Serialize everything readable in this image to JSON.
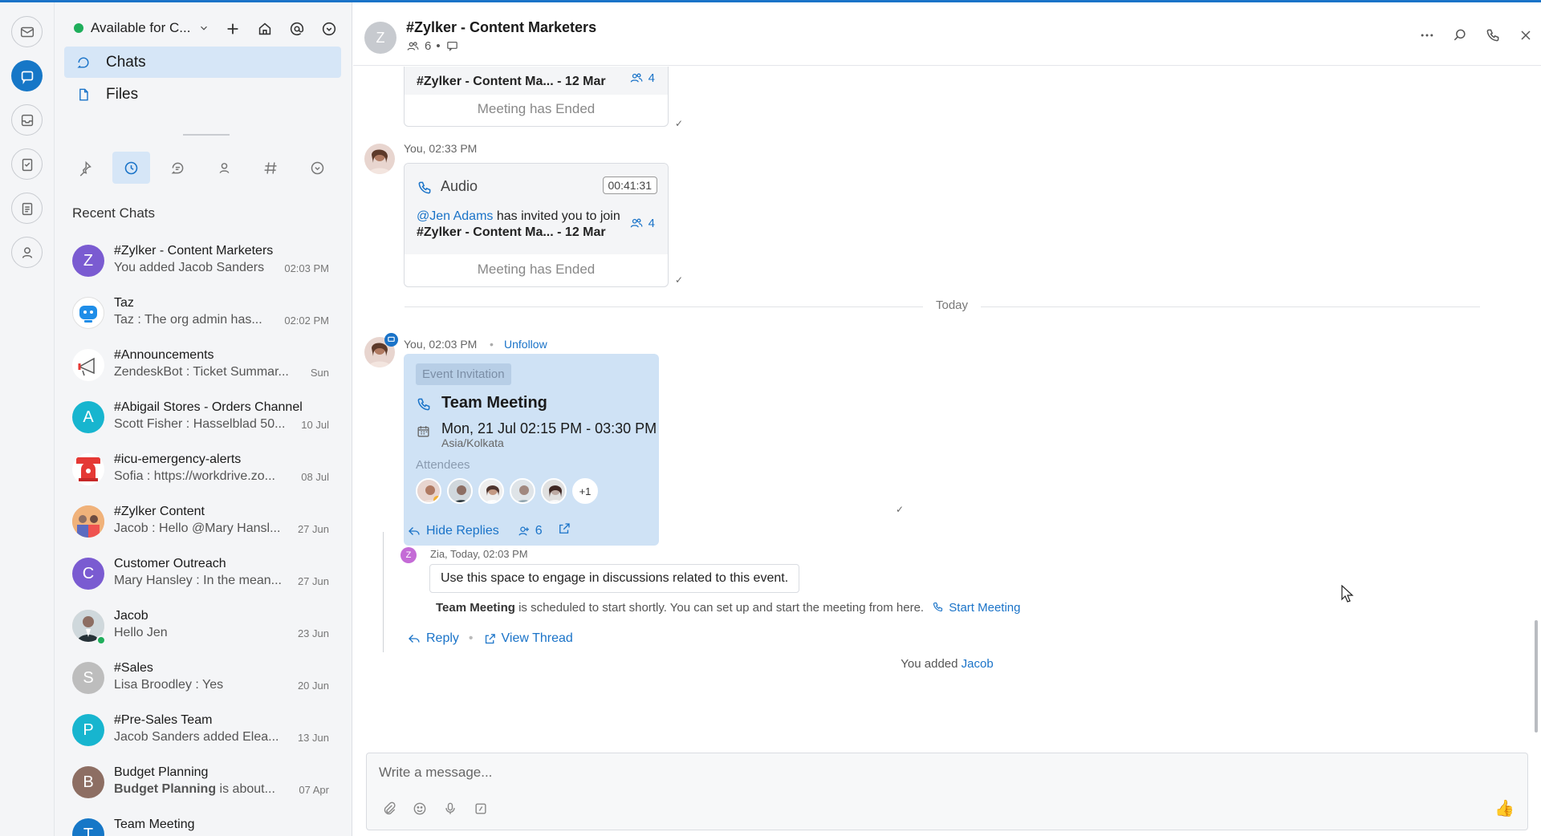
{
  "app": {
    "accent": "#1677c7"
  },
  "rail": {
    "items": [
      "mail-icon",
      "chat-icon",
      "inbox-icon",
      "tasks-icon",
      "notes-icon",
      "contacts-icon"
    ]
  },
  "sidebar": {
    "status": "Available for C...",
    "nav": [
      {
        "label": "Chats"
      },
      {
        "label": "Files"
      }
    ],
    "section_title": "Recent Chats",
    "chats": [
      {
        "name": "#Zylker - Content Marketers",
        "preview": "You added Jacob Sanders",
        "time": "02:03 PM",
        "avatar_letter": "Z",
        "color": "#7a5bd1"
      },
      {
        "name": "Taz",
        "preview": "Taz : The org admin has...",
        "time": "02:02 PM",
        "avatar_letter": "",
        "color": "#1f8de8"
      },
      {
        "name": "#Announcements",
        "preview": "ZendeskBot : Ticket Summar...",
        "time": "Sun",
        "avatar_letter": "",
        "color": "#f0f0f0"
      },
      {
        "name": "#Abigail Stores - Orders Channel",
        "preview": "Scott Fisher : Hasselblad 50...",
        "time": "10 Jul",
        "avatar_letter": "A",
        "color": "#17b5cf"
      },
      {
        "name": "#icu-emergency-alerts",
        "preview": "Sofia : https://workdrive.zo...",
        "time": "08 Jul",
        "avatar_letter": "",
        "color": "#e53935"
      },
      {
        "name": "#Zylker Content",
        "preview": "Jacob : Hello @Mary Hansl...",
        "time": "27 Jun",
        "avatar_letter": "",
        "color": "#e98f5a"
      },
      {
        "name": "Customer Outreach",
        "preview": "Mary Hansley : In the mean...",
        "time": "27 Jun",
        "avatar_letter": "C",
        "color": "#7a5bd1"
      },
      {
        "name": "Jacob",
        "preview": "Hello Jen",
        "time": "23 Jun",
        "avatar_letter": "",
        "color": "#8d6e63"
      },
      {
        "name": "#Sales",
        "preview": "Lisa Broodley : Yes",
        "time": "20 Jun",
        "avatar_letter": "S",
        "color": "#bdbdbd"
      },
      {
        "name": "#Pre-Sales Team",
        "preview": "Jacob Sanders added Elea...",
        "time": "13 Jun",
        "avatar_letter": "P",
        "color": "#17b5cf"
      },
      {
        "name": "Budget Planning",
        "preview_bold": "Budget Planning",
        "preview": " is about...",
        "time": "07 Apr",
        "avatar_letter": "B",
        "color": "#8d6e63"
      },
      {
        "name": "Team Meeting",
        "preview": "",
        "time": "",
        "avatar_letter": "T",
        "color": "#1677c7"
      }
    ]
  },
  "header": {
    "avatar_letter": "Z",
    "title": "#Zylker - Content Marketers",
    "member_count": "6"
  },
  "conversation": {
    "msg1": {
      "title": "#Zylker - Content Ma... - 12 Mar",
      "count": "4",
      "ended": "Meeting has Ended"
    },
    "msg2": {
      "sender": "You, 02:33 PM",
      "type": "Audio",
      "duration": "00:41:31",
      "mention": "@Jen Adams",
      "invite_text": " has invited you to join",
      "title": "#Zylker - Content Ma... - 12 Mar",
      "count": "4",
      "ended": "Meeting has Ended"
    },
    "divider": "Today",
    "msg3": {
      "sender": "You, 02:03 PM",
      "follow": "Unfollow",
      "tag": "Event Invitation",
      "title": "Team Meeting",
      "date": "Mon, 21 Jul 02:15 PM - 03:30 PM",
      "tz": "Asia/Kolkata",
      "attendees_label": "Attendees",
      "more": "+1",
      "hide_replies": "Hide Replies",
      "participants": "6"
    },
    "reply": {
      "avatar_letter": "Z",
      "sender": "Zia, Today, 02:03 PM",
      "text": "Use this space to engage in discussions related to this event.",
      "scheduled_bold": "Team Meeting",
      "scheduled_text": " is scheduled to start shortly. You can set up and start the meeting from here.",
      "start": "Start Meeting"
    },
    "reply_btn": "Reply",
    "view_thread": "View Thread",
    "system_prefix": "You added ",
    "system_link": "Jacob"
  },
  "composer": {
    "placeholder": "Write a message..."
  }
}
